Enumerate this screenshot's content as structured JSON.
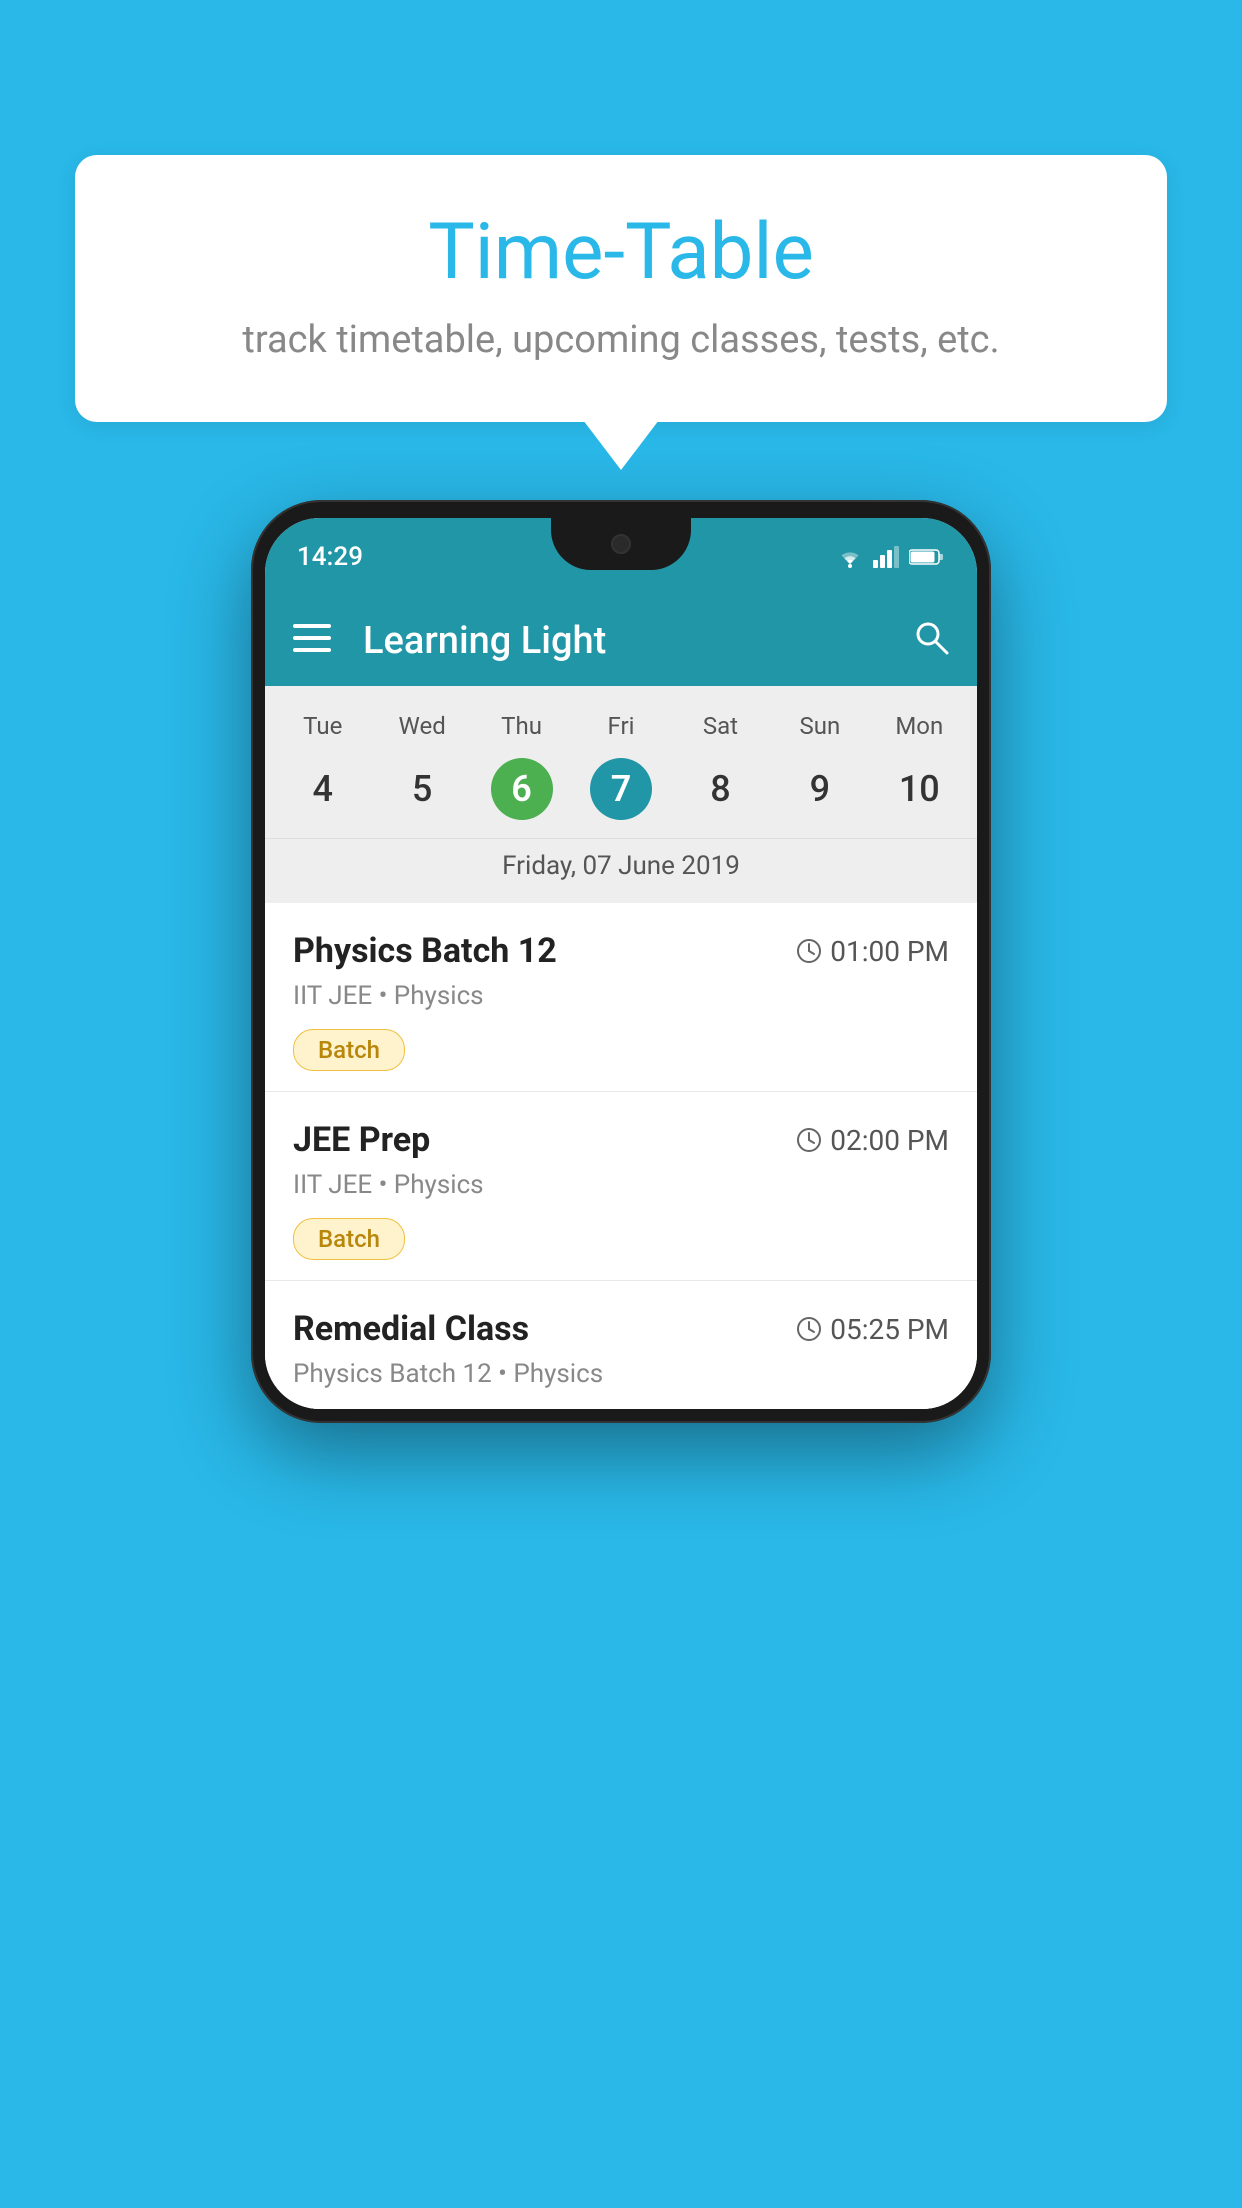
{
  "background_color": "#29B8E8",
  "speech_bubble": {
    "title": "Time-Table",
    "subtitle": "track timetable, upcoming classes, tests, etc."
  },
  "phone": {
    "status_bar": {
      "time": "14:29",
      "icons": [
        "wifi",
        "signal",
        "battery"
      ]
    },
    "app_bar": {
      "title": "Learning Light",
      "has_hamburger": true,
      "has_search": true
    },
    "calendar": {
      "days": [
        "Tue",
        "Wed",
        "Thu",
        "Fri",
        "Sat",
        "Sun",
        "Mon"
      ],
      "dates": [
        {
          "num": "4",
          "style": "normal"
        },
        {
          "num": "5",
          "style": "normal"
        },
        {
          "num": "6",
          "style": "green"
        },
        {
          "num": "7",
          "style": "blue"
        },
        {
          "num": "8",
          "style": "normal"
        },
        {
          "num": "9",
          "style": "normal"
        },
        {
          "num": "10",
          "style": "normal"
        }
      ],
      "selected_date_label": "Friday, 07 June 2019"
    },
    "schedule_items": [
      {
        "title": "Physics Batch 12",
        "time": "01:00 PM",
        "meta": "IIT JEE • Physics",
        "badge": "Batch"
      },
      {
        "title": "JEE Prep",
        "time": "02:00 PM",
        "meta": "IIT JEE • Physics",
        "badge": "Batch"
      },
      {
        "title": "Remedial Class",
        "time": "05:25 PM",
        "meta": "Physics Batch 12 • Physics",
        "badge": null,
        "partial": true
      }
    ]
  }
}
